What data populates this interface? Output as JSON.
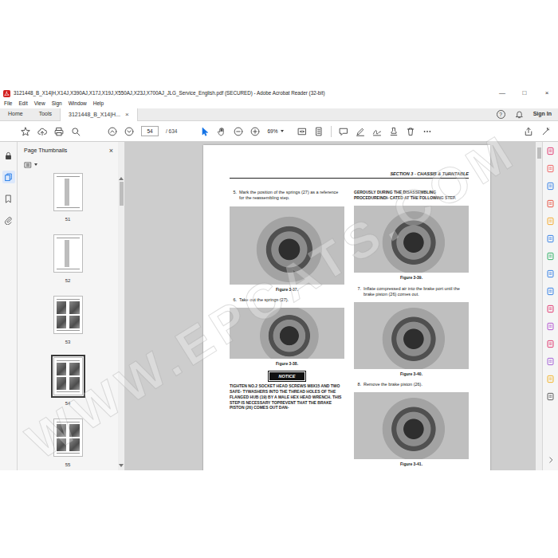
{
  "window": {
    "title": "3121448_B_X14|H,X14J,X390AJ,X17J,X19J,X550AJ,X23J,X700AJ_JLG_Service_English.pdf (SECURED) - Adobe Acrobat Reader (32-bit)",
    "controls": [
      "—",
      "□",
      "×"
    ]
  },
  "menu": [
    "File",
    "Edit",
    "View",
    "Sign",
    "Window",
    "Help"
  ],
  "tabs": [
    {
      "label": "Home",
      "selected": false
    },
    {
      "label": "Tools",
      "selected": false
    },
    {
      "label": "3121448_B_X14|H...",
      "selected": true,
      "close": "×"
    }
  ],
  "account": {
    "help": "?",
    "sign_in": "Sign In"
  },
  "toolbar": {
    "page": "54",
    "total": "/ 634",
    "zoom": "69%",
    "tools": [
      {
        "selected": true
      },
      {
        "selected": false
      }
    ]
  },
  "left_rail": [
    {
      "selected": false
    },
    {
      "selected": true
    },
    {
      "selected": false
    },
    {
      "selected": false
    }
  ],
  "side_panel": {
    "title": "Page Thumbnails",
    "close": "×",
    "thumbnails": [
      {
        "label": "51",
        "selected": false
      },
      {
        "label": "52",
        "selected": false
      },
      {
        "label": "53",
        "selected": false
      },
      {
        "label": "54",
        "selected": true
      },
      {
        "label": "55",
        "selected": false
      }
    ]
  },
  "document": {
    "header": "SECTION 3 - CHASSIS & TURNTABLE",
    "columns": [
      [
        {
          "kind": "step",
          "num": "5.",
          "text": "Mark the position of the springs (27) as a reference for the reassembling step."
        },
        {
          "kind": "figure",
          "caption": "Figure 3-37."
        },
        {
          "kind": "step",
          "num": "6.",
          "text": "Take out the springs (27)."
        },
        {
          "kind": "figure",
          "caption": "Figure 3-38."
        },
        {
          "kind": "notice",
          "text": "NOTICE"
        },
        {
          "kind": "caps",
          "text": "TIGHTEN NO.2 SOCKET HEAD SCREWS M8X15 AND TWO SAFE- TYWASHERS INTO THE THREAD HOLES OF THE FLANGED HUB (19) BY A MALE HEX HEAD WRENCH. THIS STEP IS NECESSARY TOPREVENT THAT THE BRAKE PISTON (26) COMES OUT DAN-"
        }
      ],
      [
        {
          "kind": "caps",
          "text": "GEROUSLY DURING THE DISASSEMBLING PROCEDUREINDI- CATED AT THE FOLLOWING STEP."
        },
        {
          "kind": "figure",
          "caption": "Figure 3-39."
        },
        {
          "kind": "step",
          "num": "7.",
          "text": "Inflate compressed air into the brake port until the brake piston (26) comes out."
        },
        {
          "kind": "figure",
          "caption": "Figure 3-40."
        },
        {
          "kind": "step",
          "num": "8.",
          "text": "Remove the brake piston (26)."
        },
        {
          "kind": "figure",
          "caption": "Figure 3-41."
        }
      ]
    ],
    "watermark": "WWW.EPCATS.COM"
  }
}
